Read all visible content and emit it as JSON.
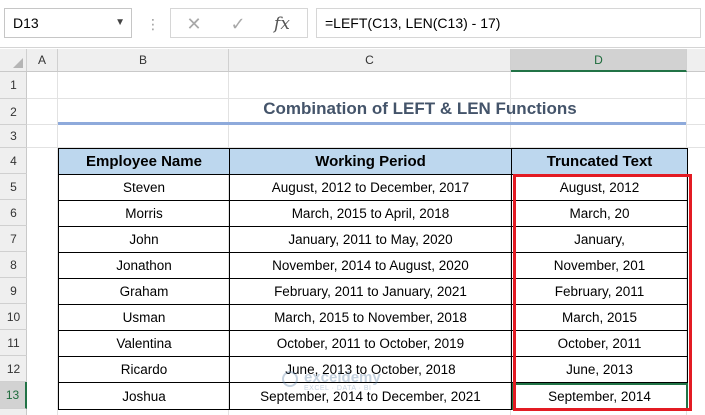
{
  "formula_bar": {
    "name_box": "D13",
    "cancel_icon": "✕",
    "enter_icon": "✓",
    "fx_label": "fx",
    "formula": "=LEFT(C13, LEN(C13) - 17)"
  },
  "columns": [
    "A",
    "B",
    "C",
    "D"
  ],
  "rows": [
    "1",
    "2",
    "3",
    "4",
    "5",
    "6",
    "7",
    "8",
    "9",
    "10",
    "11",
    "12",
    "13"
  ],
  "sheet": {
    "title": "Combination of LEFT & LEN Functions",
    "headers": [
      "Employee Name",
      "Working Period",
      "Truncated Text"
    ],
    "data": [
      [
        "Steven",
        "August, 2012 to December, 2017",
        "August, 2012"
      ],
      [
        "Morris",
        "March, 2015 to April, 2018",
        "March, 20"
      ],
      [
        "John",
        "January, 2011 to May, 2020",
        "January,"
      ],
      [
        "Jonathon",
        "November, 2014 to August, 2020",
        "November, 201"
      ],
      [
        "Graham",
        "February, 2011 to January, 2021",
        "February, 2011"
      ],
      [
        "Usman",
        "March, 2015 to November, 2018",
        "March, 2015"
      ],
      [
        "Valentina",
        "October, 2011 to October, 2019",
        "October, 2011"
      ],
      [
        "Ricardo",
        "June, 2013 to October, 2018",
        "June, 2013"
      ],
      [
        "Joshua",
        "September, 2014 to December, 2021",
        "September, 2014"
      ]
    ]
  },
  "watermark": {
    "name": "exceldemy",
    "tagline": "EXCEL · DATA · BI"
  },
  "colors": {
    "header_fill": "#bdd7ee",
    "title_text": "#44546a",
    "title_underline": "#8eaadb",
    "highlight_border": "#e31b23",
    "selection": "#217346"
  }
}
